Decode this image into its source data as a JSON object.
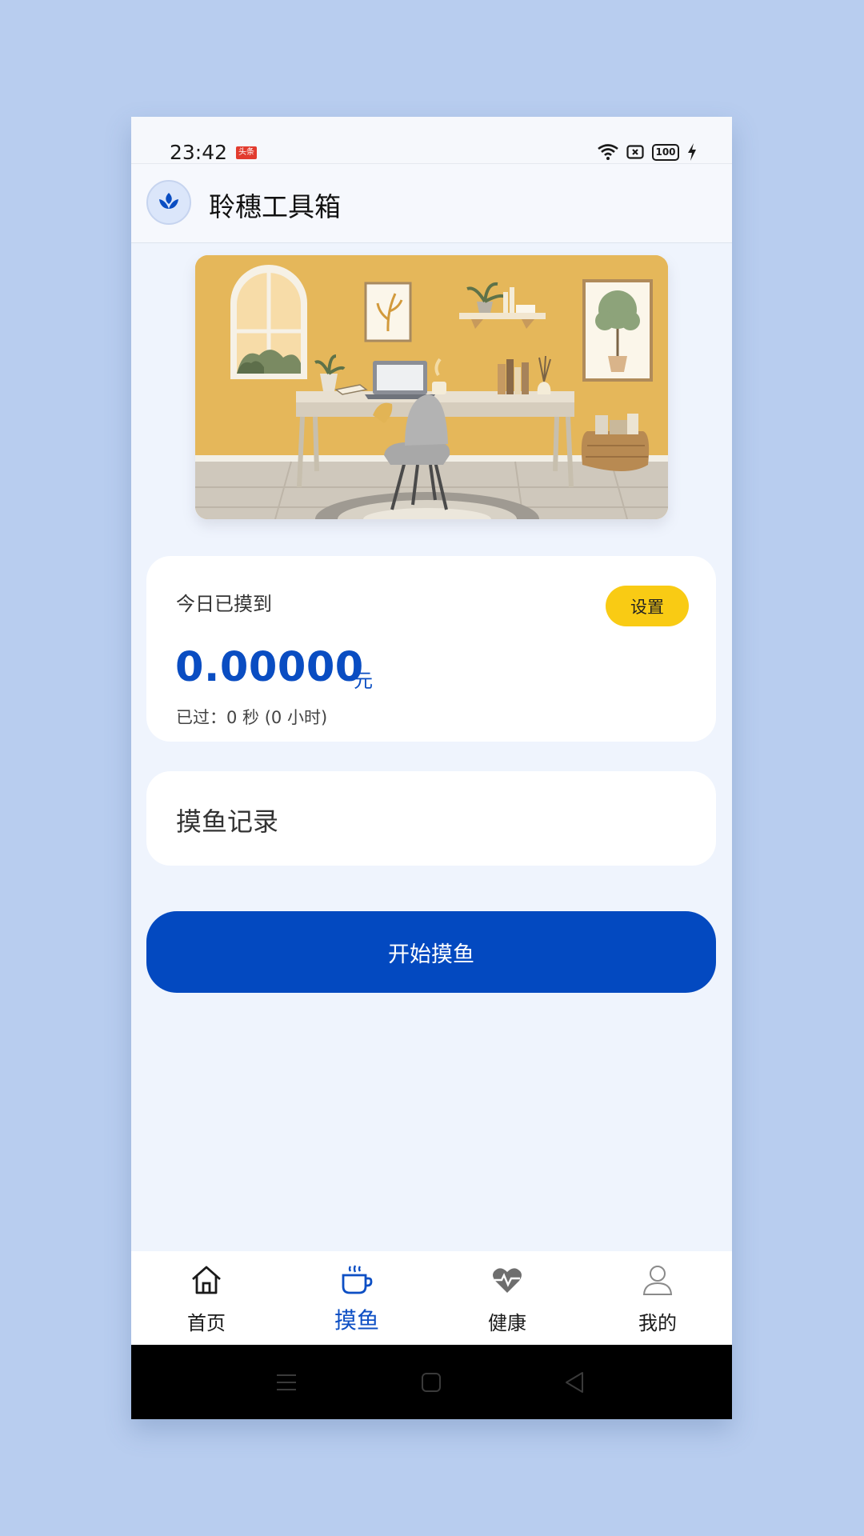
{
  "status": {
    "time": "23:42",
    "news_badge": "头条",
    "battery": "100"
  },
  "app": {
    "title": "聆穗工具箱"
  },
  "earnings": {
    "label": "今日已摸到",
    "settings_label": "设置",
    "value": "0.00000",
    "unit": "元",
    "elapsed": "已过：0 秒 (0 小时)"
  },
  "records": {
    "label": "摸鱼记录"
  },
  "start_button": {
    "label": "开始摸鱼"
  },
  "tabs": [
    {
      "label": "首页",
      "icon": "home-icon",
      "active": false
    },
    {
      "label": "摸鱼",
      "icon": "cup-icon",
      "active": true
    },
    {
      "label": "健康",
      "icon": "heart-icon",
      "active": false
    },
    {
      "label": "我的",
      "icon": "user-icon",
      "active": false
    }
  ],
  "colors": {
    "primary": "#0349c0",
    "accent_yellow": "#f9cb14",
    "background": "#eff4fd",
    "outer_background": "#b8cdef"
  }
}
